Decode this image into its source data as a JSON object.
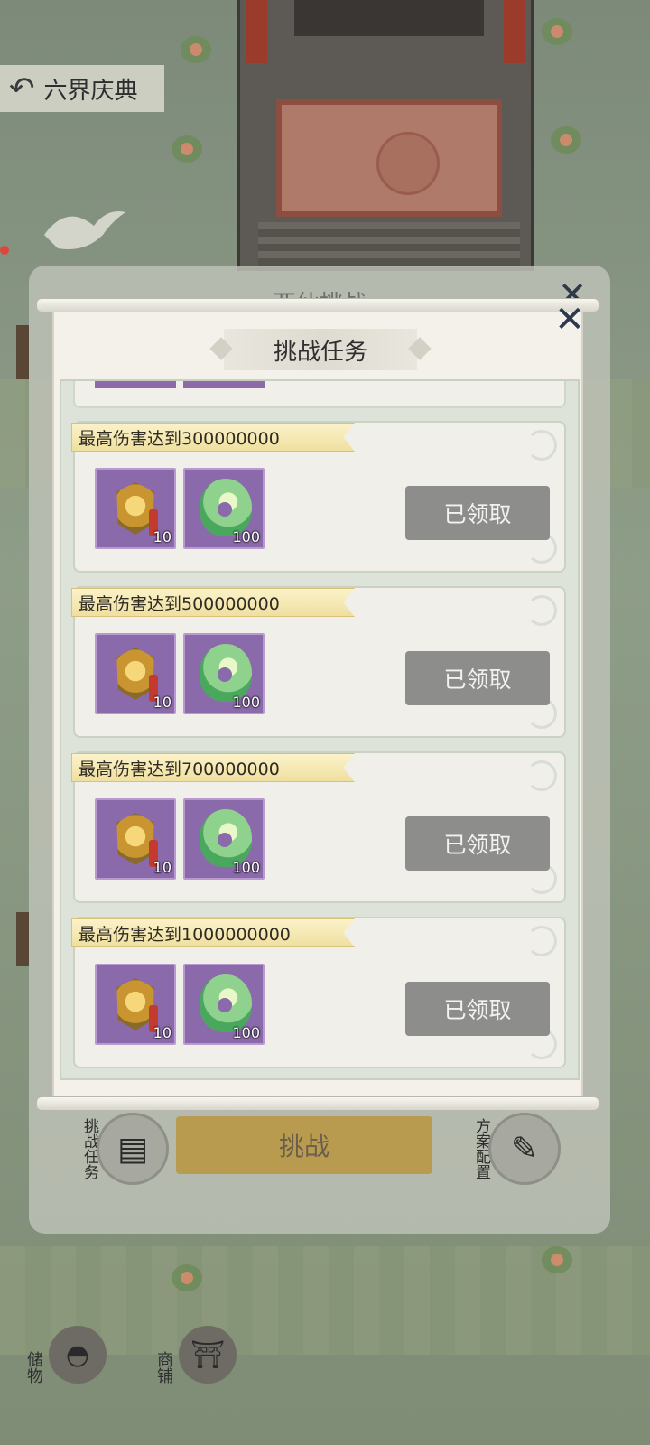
{
  "scene": {
    "back_label": "六界庆典",
    "icons": [
      "back-arrow-icon",
      "crane-icon",
      "temple",
      "storage-bag-icon",
      "shop-gate-icon"
    ]
  },
  "bottom_nav": {
    "storage_label": "储物",
    "shop_label": "商铺"
  },
  "outer_panel": {
    "title": "亚仙挑战",
    "challenge_button": "挑战",
    "left_tool_label": "挑战任务",
    "right_tool_label": "方案配置"
  },
  "dialog": {
    "title": "挑战任务",
    "tasks": [
      {
        "label": "最高伤害达到300000000",
        "rewards": [
          {
            "icon": "gold-token-icon",
            "qty": "10"
          },
          {
            "icon": "jade-pendant-icon",
            "qty": "100"
          }
        ],
        "status": "已领取"
      },
      {
        "label": "最高伤害达到500000000",
        "rewards": [
          {
            "icon": "gold-token-icon",
            "qty": "10"
          },
          {
            "icon": "jade-pendant-icon",
            "qty": "100"
          }
        ],
        "status": "已领取"
      },
      {
        "label": "最高伤害达到700000000",
        "rewards": [
          {
            "icon": "gold-token-icon",
            "qty": "10"
          },
          {
            "icon": "jade-pendant-icon",
            "qty": "100"
          }
        ],
        "status": "已领取"
      },
      {
        "label": "最高伤害达到1000000000",
        "rewards": [
          {
            "icon": "gold-token-icon",
            "qty": "10"
          },
          {
            "icon": "jade-pendant-icon",
            "qty": "100"
          }
        ],
        "status": "已领取"
      }
    ]
  },
  "colors": {
    "claimed_button": "#8d8d8b",
    "ribbon": "#f4e7b2",
    "reward_bg": "#8b6aab",
    "challenge_button": "#b89b4f"
  }
}
